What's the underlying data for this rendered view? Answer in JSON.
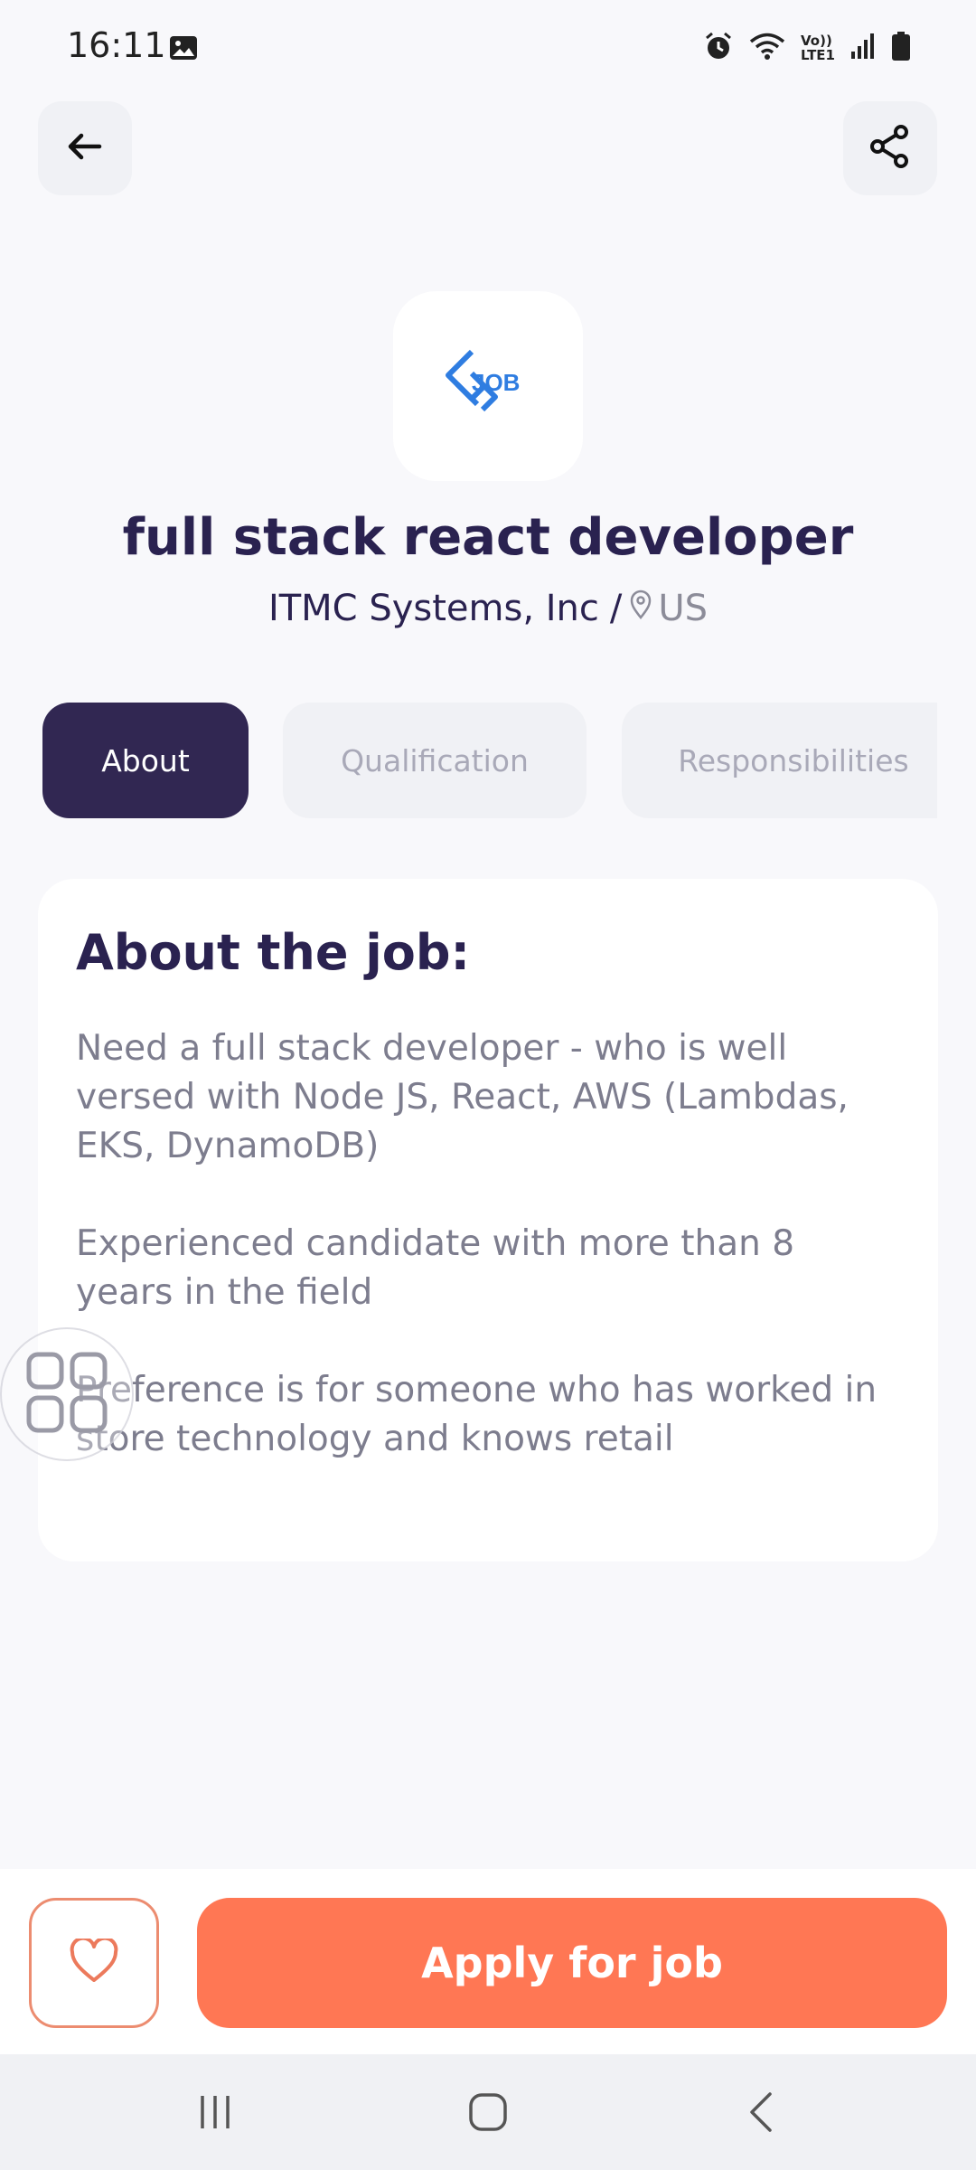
{
  "status_bar": {
    "time": "16:11",
    "icons": [
      "image-icon",
      "alarm-icon",
      "wifi-icon",
      "volte-icon",
      "signal-icon",
      "battery-icon"
    ],
    "volte_label": "Vo))",
    "lte_label": "LTE1"
  },
  "header": {
    "back_icon": "arrow-left-icon",
    "share_icon": "share-icon"
  },
  "job": {
    "logo_text": "JOB",
    "title": "full stack react developer",
    "company": "ITMC Systems, Inc",
    "separator": "/",
    "location": "US"
  },
  "tabs": [
    {
      "label": "About",
      "active": true
    },
    {
      "label": "Qualification",
      "active": false
    },
    {
      "label": "Responsibilities",
      "active": false
    }
  ],
  "about": {
    "heading": "About the job:",
    "paragraphs": [
      "Need a full stack developer - who is well versed with Node JS, React, AWS (Lambdas, EKS, DynamoDB)",
      "Experienced candidate with more than 8 years in the field",
      "Preference is for someone who has worked in store technology and knows retail"
    ]
  },
  "actions": {
    "favorite_icon": "heart-icon",
    "apply_label": "Apply for job"
  },
  "colors": {
    "primary_dark": "#312752",
    "accent": "#ff7754",
    "logo_blue": "#2f7de1",
    "muted_text": "#7d7d8e"
  }
}
